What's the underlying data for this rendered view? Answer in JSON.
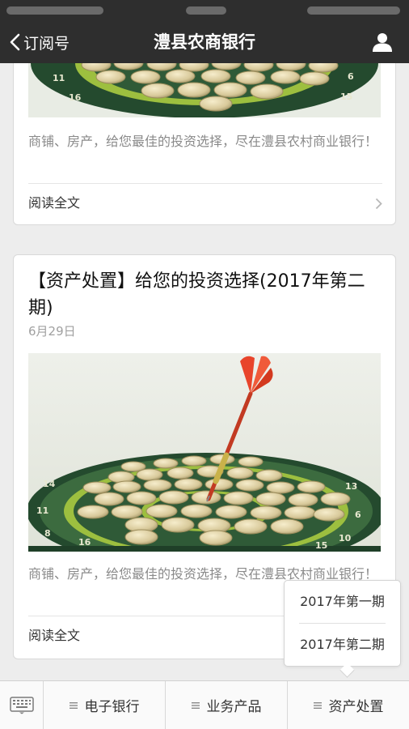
{
  "navbar": {
    "back_label": "订阅号",
    "title": "澧县农商银行"
  },
  "articles": [
    {
      "excerpt": "商铺、房产，给您最佳的投资选择，尽在澧县农村商业银行！",
      "read_more": "阅读全文"
    },
    {
      "title": "【资产处置】给您的投资选择(2017年第二期)",
      "date": "6月29日",
      "excerpt": "商铺、房产，给您最佳的投资选择，尽在澧县农村商业银行！",
      "read_more": "阅读全文"
    }
  ],
  "bottom_menu": {
    "tabs": [
      {
        "label": "电子银行"
      },
      {
        "label": "业务产品"
      },
      {
        "label": "资产处置"
      }
    ],
    "submenu": [
      {
        "label": "2017年第一期"
      },
      {
        "label": "2017年第二期"
      }
    ]
  },
  "colors": {
    "navbar_bg": "#2e2e2e",
    "page_bg": "#ededed",
    "dart_red": "#e8442b",
    "board_green": "#2f5a37"
  }
}
